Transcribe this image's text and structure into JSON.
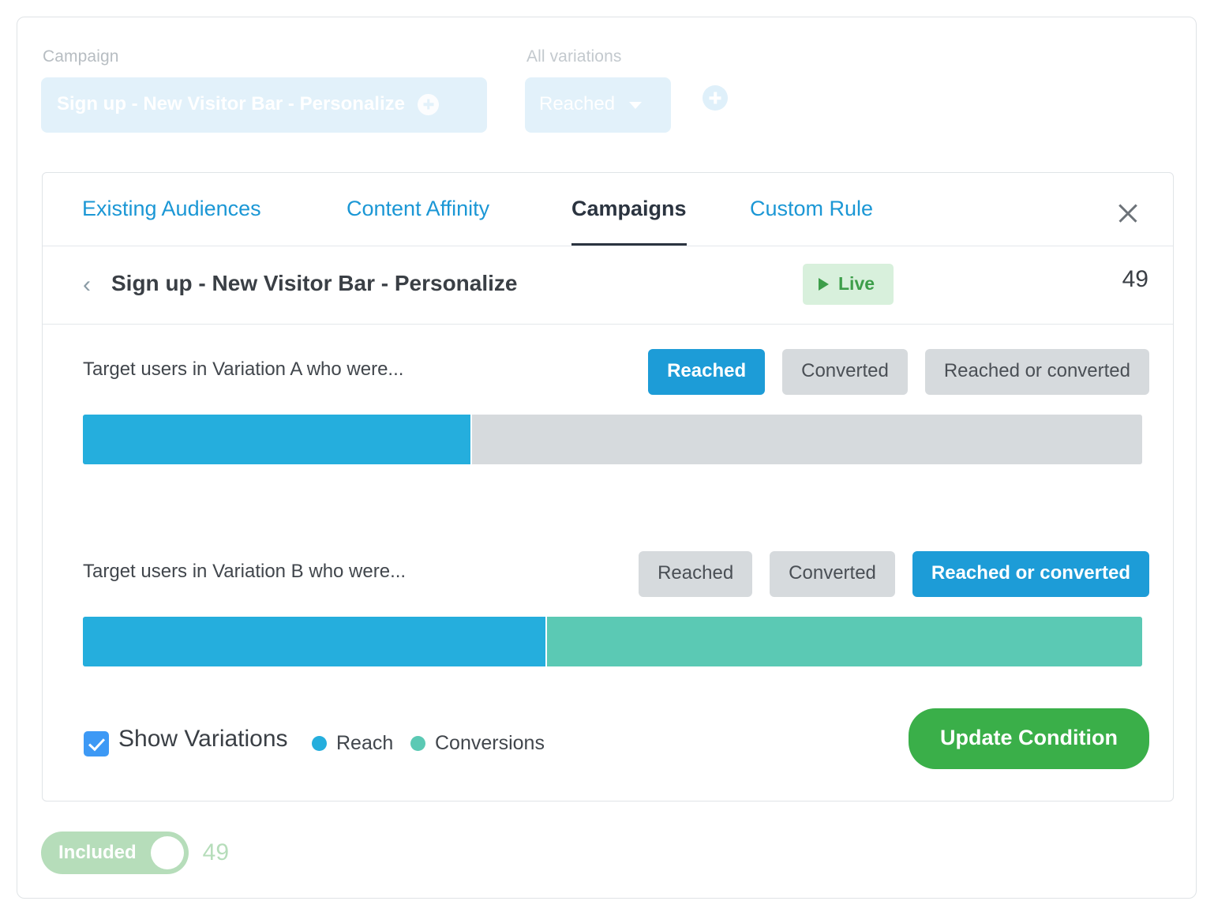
{
  "filters": {
    "campaign_label": "Campaign",
    "campaign_value": "Sign up - New Visitor Bar - Personalize",
    "variations_label": "All variations",
    "variation_value": "Reached"
  },
  "tabs": [
    {
      "label": "Existing Audiences",
      "active": false
    },
    {
      "label": "Content Affinity",
      "active": false
    },
    {
      "label": "Campaigns",
      "active": true
    },
    {
      "label": "Custom Rule",
      "active": false
    }
  ],
  "campaign_header": {
    "title": "Sign up - New Visitor Bar - Personalize",
    "status": "Live",
    "count": "49"
  },
  "variations": [
    {
      "text": "Target users in Variation A who were...",
      "options": [
        "Reached",
        "Converted",
        "Reached or converted"
      ],
      "selected": "Reached"
    },
    {
      "text": "Target users in Variation B who were...",
      "options": [
        "Reached",
        "Converted",
        "Reached or converted"
      ],
      "selected": "Reached or converted"
    }
  ],
  "footer": {
    "show_variations_label": "Show Variations",
    "legend_reach": "Reach",
    "legend_conversions": "Conversions",
    "update_label": "Update Condition"
  },
  "bottom": {
    "included_label": "Included",
    "included_count": "49"
  },
  "colors": {
    "reach": "#25aedd",
    "conversions": "#5bc9b4",
    "track": "#d6dadd",
    "accent_blue": "#1d9cd7",
    "green": "#3aaf49",
    "live_green": "#3d9e4a"
  },
  "chart_data": {
    "type": "bar",
    "title": "",
    "orientation": "horizontal",
    "stacked": true,
    "max": 100,
    "series": [
      {
        "name": "Reach",
        "color": "#25aedd",
        "values": [
          36.6,
          43.8
        ]
      },
      {
        "name": "Conversions",
        "color": "#5bc9b4",
        "values": [
          0,
          56.2
        ]
      }
    ],
    "categories": [
      "Variation A",
      "Variation B"
    ],
    "track_color": "#d6dadd",
    "legend": [
      "Reach",
      "Conversions"
    ],
    "legend_position": "bottom-left"
  }
}
